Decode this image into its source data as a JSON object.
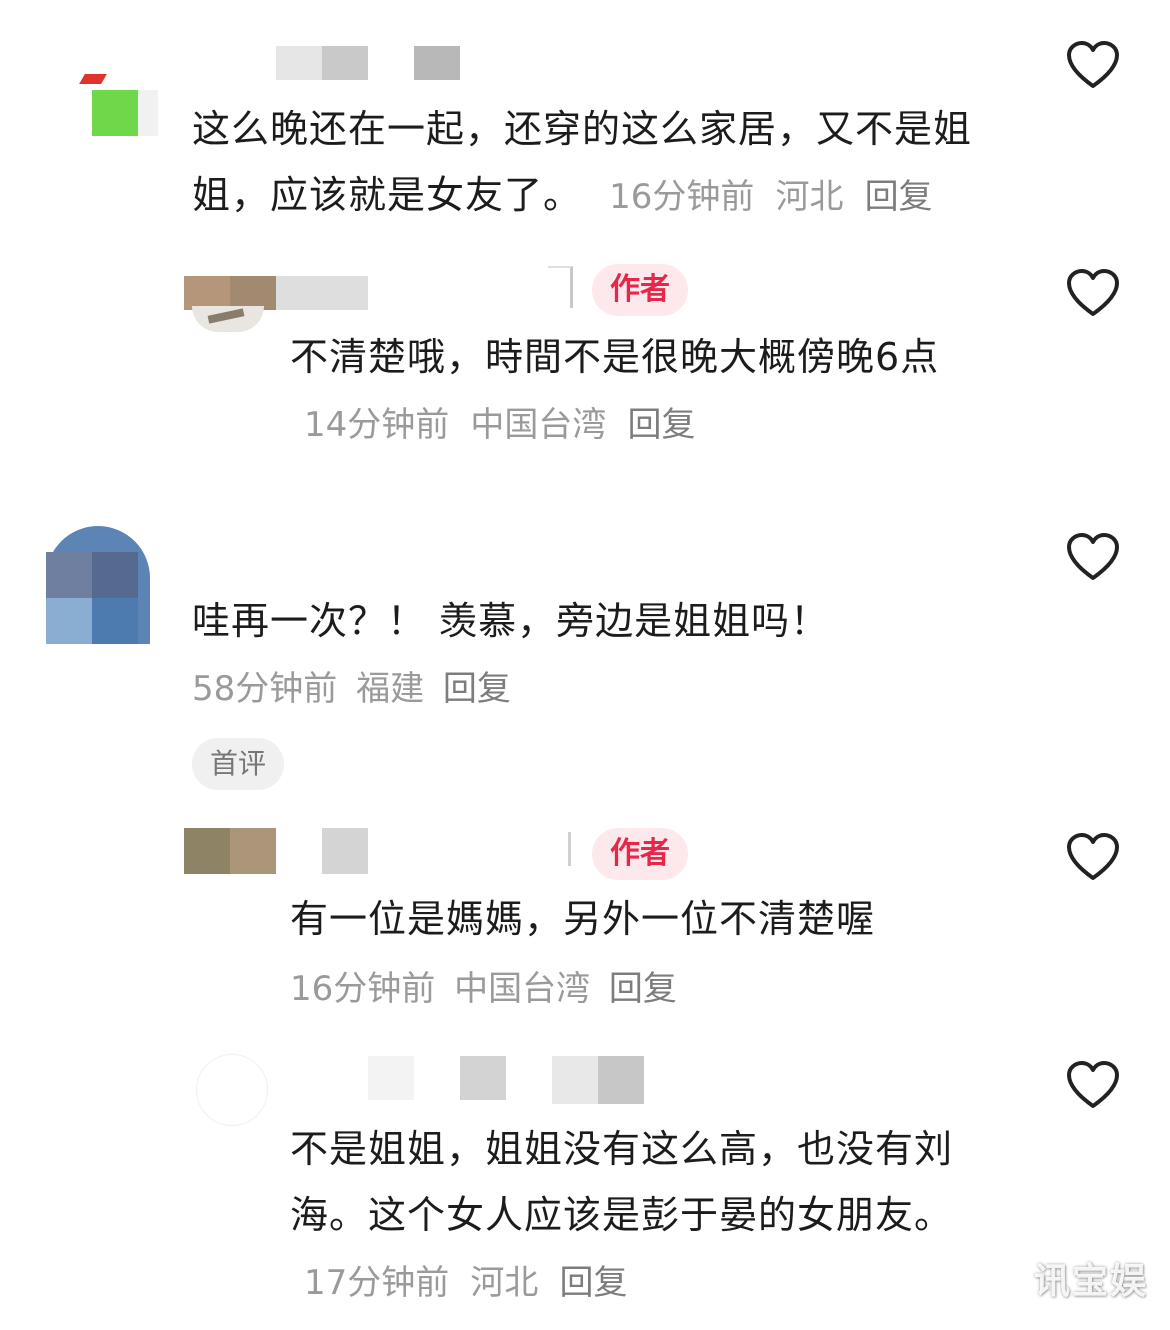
{
  "comments": [
    {
      "text": "这么晚还在一起，还穿的这么家居，又不是姐姐，应该就是女友了。",
      "time": "16分钟前",
      "region": "河北",
      "reply_label": "回复"
    },
    {
      "author_badge": "作者",
      "text": "不清楚哦，時間不是很晚大概傍晚6点",
      "time": "14分钟前",
      "region": "中国台湾",
      "reply_label": "回复"
    },
    {
      "text": "哇再一次？！ 羡慕，旁边是姐姐吗！",
      "time": "58分钟前",
      "region": "福建",
      "reply_label": "回复",
      "first_badge": "首评"
    },
    {
      "author_badge": "作者",
      "text": "有一位是媽媽，另外一位不清楚喔",
      "time": "16分钟前",
      "region": "中国台湾",
      "reply_label": "回复"
    },
    {
      "text": "不是姐姐，姐姐没有这么高，也没有刘海。这个女人应该是彭于晏的女朋友。",
      "time": "17分钟前",
      "region": "河北",
      "reply_label": "回复"
    }
  ],
  "icons": {
    "like": "heart-outline-icon"
  },
  "colors": {
    "author_badge_bg": "#fde8ec",
    "author_badge_text": "#e8264a",
    "meta": "#9a9a9a"
  },
  "watermark": "讯宝娱"
}
